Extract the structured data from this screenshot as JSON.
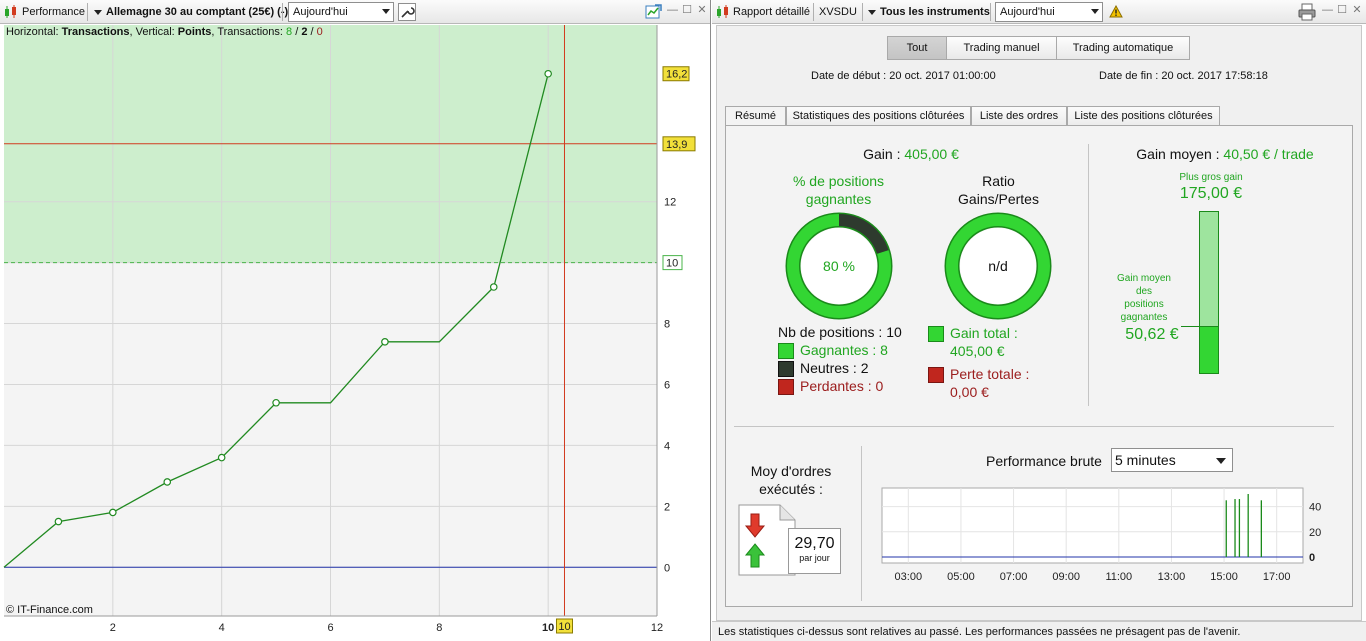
{
  "left_toolbar": {
    "app_label": "Performance",
    "instrument_label": "Allemagne 30 au comptant (25€) (-)",
    "period_value": "Aujourd'hui"
  },
  "chart_info": {
    "prefix": "Horizontal: ",
    "horizontal_value": "Transactions",
    "mid": ", Vertical: ",
    "vertical_value": "Points",
    "tx_label": ", Transactions: ",
    "tx_win": "8",
    "tx_slash1": " / ",
    "tx_neutral": "2",
    "tx_slash2": " / ",
    "tx_loss": "0",
    "copyright": "© IT-Finance.com"
  },
  "chart_data": {
    "type": "line",
    "xlabel": "",
    "ylabel": "",
    "xlim": [
      0,
      12
    ],
    "ylim": [
      -1.6,
      17.8
    ],
    "x_ticks": [
      "2",
      "4",
      "6",
      "8",
      "10",
      "12"
    ],
    "y_ticks": [
      "0",
      "2",
      "4",
      "6",
      "8",
      "10",
      "12"
    ],
    "points": [
      {
        "x": 0,
        "y": 0
      },
      {
        "x": 1,
        "y": 1.5
      },
      {
        "x": 2,
        "y": 1.8
      },
      {
        "x": 3,
        "y": 2.8
      },
      {
        "x": 4,
        "y": 3.6
      },
      {
        "x": 5,
        "y": 5.4
      },
      {
        "x": 6,
        "y": 5.4
      },
      {
        "x": 7,
        "y": 7.4
      },
      {
        "x": 8,
        "y": 7.4
      },
      {
        "x": 9,
        "y": 9.2
      },
      {
        "x": 10,
        "y": 16.2
      }
    ],
    "markers": [
      false,
      true,
      true,
      true,
      true,
      true,
      false,
      true,
      false,
      true,
      true
    ],
    "hlines": [
      {
        "y": 13.9,
        "label": "13,9",
        "color": "#d23b1f"
      },
      {
        "y": 10,
        "label": "10",
        "color": "#49b449"
      }
    ],
    "last_value_label": "16,2",
    "vline": {
      "x": 10.3,
      "label": "10"
    },
    "zero_line_color": "#2233aa",
    "line_color": "#218a21",
    "highlight_from": 10,
    "colors": {
      "band": "#cdeecd",
      "background": "#f4f4f4"
    }
  },
  "right_toolbar": {
    "report_label": "Rapport détaillé",
    "account": "XVSDU",
    "instruments_label": "Tous les instruments",
    "period_value": "Aujourd'hui"
  },
  "segments": [
    {
      "label": "Tout",
      "active": true
    },
    {
      "label": "Trading manuel",
      "active": false
    },
    {
      "label": "Trading automatique",
      "active": false
    }
  ],
  "dates": {
    "start_label": "Date de début :",
    "start_value": "20 oct. 2017 01:00:00",
    "end_label": "Date de fin :",
    "end_value": "20 oct. 2017 17:58:18"
  },
  "tabs": [
    {
      "label": "Résumé",
      "active": true
    },
    {
      "label": "Statistiques des positions clôturées",
      "active": false
    },
    {
      "label": "Liste des ordres",
      "active": false
    },
    {
      "label": "Liste des positions clôturées",
      "active": false
    }
  ],
  "summary": {
    "gain_label": "Gain : ",
    "gain_value": "405,00 €",
    "pct_title_1": "% de positions",
    "pct_title_2": "gagnantes",
    "pct_value": "80 %",
    "pct_fraction": 0.8,
    "ratio_title_1": "Ratio",
    "ratio_title_2": "Gains/Pertes",
    "ratio_value": "n/d",
    "nb_label": "Nb de positions",
    "nb_value": "10",
    "winners": "Gagnantes : 8",
    "neutral": "Neutres : 2",
    "losers": "Perdantes : 0",
    "gain_total_label": "Gain total :",
    "gain_total_value": "405,00 €",
    "loss_total_label": "Perte totale :",
    "loss_total_value": "0,00 €",
    "avg_gain_label": "Gain moyen : ",
    "avg_gain_value": "40,50 € / trade",
    "max_gain_label": "Plus gros gain",
    "max_gain_value": "175,00 €",
    "avg_win_label_1": "Gain moyen",
    "avg_win_label_2": "des",
    "avg_win_label_3": "positions",
    "avg_win_label_4": "gagnantes",
    "avg_win_value": "50,62 €",
    "avg_win_fraction": 0.2893,
    "colors": {
      "green": "#21a621",
      "dark": "#2e3a2e",
      "red": "#c0261e",
      "gauge": "#33d633"
    }
  },
  "orders": {
    "title_1": "Moy d'ordres",
    "title_2": "exécutés :",
    "value": "29,70",
    "unit": "par jour"
  },
  "perf_brute": {
    "label": "Performance brute",
    "interval": "5 minutes",
    "x_ticks": [
      "03:00",
      "05:00",
      "07:00",
      "09:00",
      "11:00",
      "13:00",
      "15:00",
      "17:00"
    ],
    "y_ticks": [
      "40",
      "20",
      "0"
    ],
    "ylim": [
      0,
      50
    ],
    "bars": [
      {
        "t": "15:05",
        "v": 45
      },
      {
        "t": "15:25",
        "v": 46
      },
      {
        "t": "15:35",
        "v": 46
      },
      {
        "t": "15:55",
        "v": 50
      },
      {
        "t": "16:25",
        "v": 45
      }
    ]
  },
  "footer": {
    "text": "Les statistiques ci-dessus sont relatives au passé. Les performances passées ne présagent pas de l'avenir."
  }
}
